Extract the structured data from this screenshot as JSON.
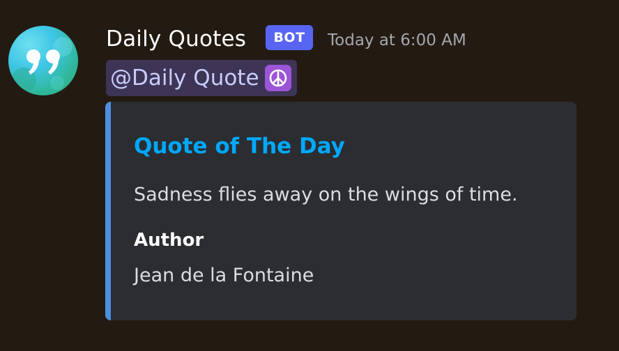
{
  "message": {
    "author": "Daily Quotes",
    "badge": "BOT",
    "timestamp": "Today at 6:00 AM",
    "mention": "@Daily Quote",
    "mention_emoji": "peace-symbol-icon",
    "avatar_icon": "quote-marks-icon"
  },
  "embed": {
    "title": "Quote of The Day",
    "description": "Sadness flies away on the wings of time.",
    "fields": [
      {
        "name": "Author",
        "value": "Jean de la Fontaine"
      }
    ]
  },
  "colors": {
    "background": "#231b12",
    "embed_bg": "#2b2d31",
    "embed_accent": "#4c8fe0",
    "title": "#00a8fc",
    "bot_badge": "#5865f2",
    "mention_bg": "#3d3456",
    "emoji_bg": "#9b55d6"
  }
}
